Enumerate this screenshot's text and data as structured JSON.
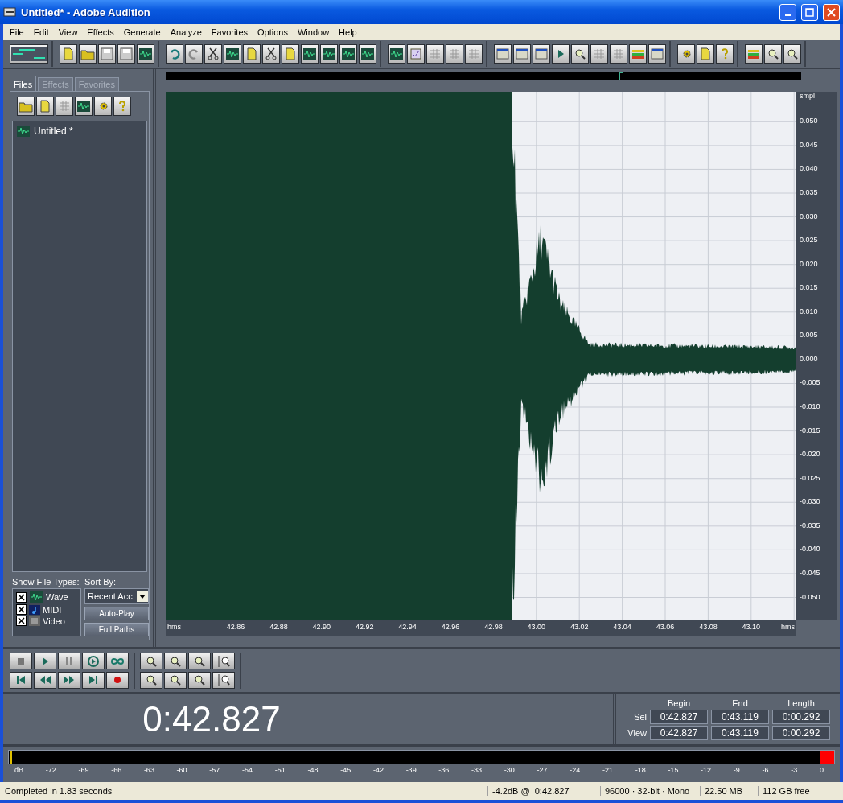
{
  "window": {
    "title": "Untitled* - Adobe Audition"
  },
  "menu": [
    "File",
    "Edit",
    "View",
    "Effects",
    "Generate",
    "Analyze",
    "Favorites",
    "Options",
    "Window",
    "Help"
  ],
  "panel": {
    "tabs": [
      {
        "label": "Files",
        "selected": true
      },
      {
        "label": "Effects",
        "selected": false
      },
      {
        "label": "Favorites",
        "selected": false
      }
    ],
    "files": [
      {
        "name": "Untitled *",
        "selected": false
      }
    ],
    "show_file_types_label": "Show File Types:",
    "file_types": [
      {
        "kind": "wave",
        "label": "Wave",
        "checked": true
      },
      {
        "kind": "midi",
        "label": "MIDI",
        "checked": true
      },
      {
        "kind": "video",
        "label": "Video",
        "checked": true
      }
    ],
    "sort_label": "Sort By:",
    "sort_value": "Recent Acc",
    "buttons": [
      "Auto-Play",
      "Full Paths"
    ]
  },
  "editor": {
    "time_axis": {
      "start_label": "hms",
      "ticks": [
        "42.86",
        "42.88",
        "42.90",
        "42.92",
        "42.94",
        "42.96",
        "42.98",
        "43.00",
        "43.02",
        "43.04",
        "43.06",
        "43.08",
        "43.10"
      ],
      "end_label": "hms"
    },
    "amplitude_axis": {
      "unit": "smpl",
      "ticks": [
        "0.050",
        "0.045",
        "0.040",
        "0.035",
        "0.030",
        "0.025",
        "0.020",
        "0.015",
        "0.010",
        "0.005",
        "0.000",
        "-0.005",
        "-0.010",
        "-0.015",
        "-0.020",
        "-0.025",
        "-0.030",
        "-0.035",
        "-0.040",
        "-0.045",
        "-0.050"
      ]
    }
  },
  "time_display": "0:42.827",
  "selection": {
    "columns": [
      "Begin",
      "End",
      "Length"
    ],
    "rows": [
      {
        "label": "Sel",
        "values": [
          "0:42.827",
          "0:43.119",
          "0:00.292"
        ]
      },
      {
        "label": "View",
        "values": [
          "0:42.827",
          "0:43.119",
          "0:00.292"
        ]
      }
    ]
  },
  "meter": {
    "labels": [
      "dB",
      "-72",
      "-69",
      "-66",
      "-63",
      "-60",
      "-57",
      "-54",
      "-51",
      "-48",
      "-45",
      "-42",
      "-39",
      "-36",
      "-33",
      "-30",
      "-27",
      "-24",
      "-21",
      "-18",
      "-15",
      "-12",
      "-9",
      "-6",
      "-3",
      "0"
    ],
    "clip": true
  },
  "status_bar": {
    "message": "Completed in 1.83 seconds",
    "fields": [
      "-4.2dB @  0:42.827",
      "96000 · 32-bit · Mono",
      "22.50 MB",
      "112 GB free"
    ]
  }
}
